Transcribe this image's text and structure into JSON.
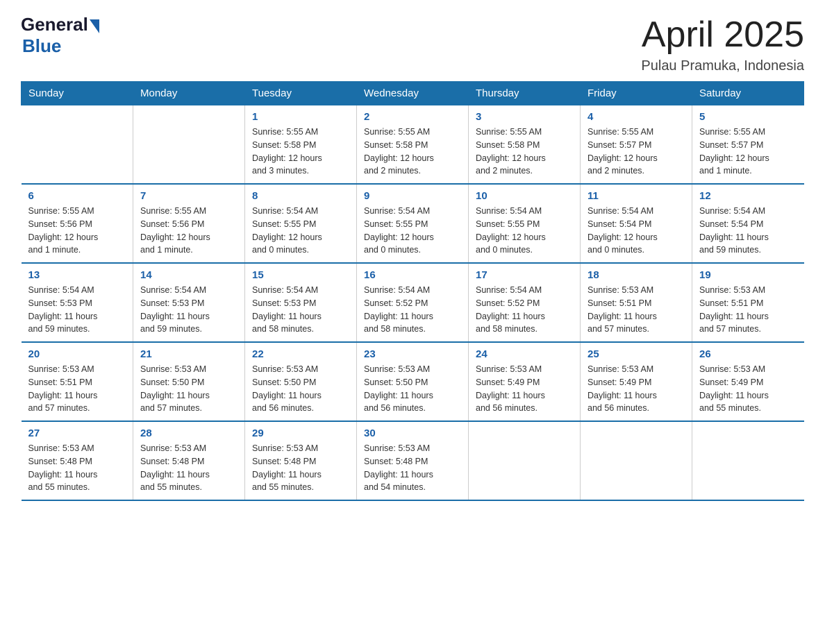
{
  "logo": {
    "general": "General",
    "blue": "Blue"
  },
  "title": "April 2025",
  "location": "Pulau Pramuka, Indonesia",
  "weekdays": [
    "Sunday",
    "Monday",
    "Tuesday",
    "Wednesday",
    "Thursday",
    "Friday",
    "Saturday"
  ],
  "weeks": [
    [
      {
        "day": "",
        "info": ""
      },
      {
        "day": "",
        "info": ""
      },
      {
        "day": "1",
        "info": "Sunrise: 5:55 AM\nSunset: 5:58 PM\nDaylight: 12 hours\nand 3 minutes."
      },
      {
        "day": "2",
        "info": "Sunrise: 5:55 AM\nSunset: 5:58 PM\nDaylight: 12 hours\nand 2 minutes."
      },
      {
        "day": "3",
        "info": "Sunrise: 5:55 AM\nSunset: 5:58 PM\nDaylight: 12 hours\nand 2 minutes."
      },
      {
        "day": "4",
        "info": "Sunrise: 5:55 AM\nSunset: 5:57 PM\nDaylight: 12 hours\nand 2 minutes."
      },
      {
        "day": "5",
        "info": "Sunrise: 5:55 AM\nSunset: 5:57 PM\nDaylight: 12 hours\nand 1 minute."
      }
    ],
    [
      {
        "day": "6",
        "info": "Sunrise: 5:55 AM\nSunset: 5:56 PM\nDaylight: 12 hours\nand 1 minute."
      },
      {
        "day": "7",
        "info": "Sunrise: 5:55 AM\nSunset: 5:56 PM\nDaylight: 12 hours\nand 1 minute."
      },
      {
        "day": "8",
        "info": "Sunrise: 5:54 AM\nSunset: 5:55 PM\nDaylight: 12 hours\nand 0 minutes."
      },
      {
        "day": "9",
        "info": "Sunrise: 5:54 AM\nSunset: 5:55 PM\nDaylight: 12 hours\nand 0 minutes."
      },
      {
        "day": "10",
        "info": "Sunrise: 5:54 AM\nSunset: 5:55 PM\nDaylight: 12 hours\nand 0 minutes."
      },
      {
        "day": "11",
        "info": "Sunrise: 5:54 AM\nSunset: 5:54 PM\nDaylight: 12 hours\nand 0 minutes."
      },
      {
        "day": "12",
        "info": "Sunrise: 5:54 AM\nSunset: 5:54 PM\nDaylight: 11 hours\nand 59 minutes."
      }
    ],
    [
      {
        "day": "13",
        "info": "Sunrise: 5:54 AM\nSunset: 5:53 PM\nDaylight: 11 hours\nand 59 minutes."
      },
      {
        "day": "14",
        "info": "Sunrise: 5:54 AM\nSunset: 5:53 PM\nDaylight: 11 hours\nand 59 minutes."
      },
      {
        "day": "15",
        "info": "Sunrise: 5:54 AM\nSunset: 5:53 PM\nDaylight: 11 hours\nand 58 minutes."
      },
      {
        "day": "16",
        "info": "Sunrise: 5:54 AM\nSunset: 5:52 PM\nDaylight: 11 hours\nand 58 minutes."
      },
      {
        "day": "17",
        "info": "Sunrise: 5:54 AM\nSunset: 5:52 PM\nDaylight: 11 hours\nand 58 minutes."
      },
      {
        "day": "18",
        "info": "Sunrise: 5:53 AM\nSunset: 5:51 PM\nDaylight: 11 hours\nand 57 minutes."
      },
      {
        "day": "19",
        "info": "Sunrise: 5:53 AM\nSunset: 5:51 PM\nDaylight: 11 hours\nand 57 minutes."
      }
    ],
    [
      {
        "day": "20",
        "info": "Sunrise: 5:53 AM\nSunset: 5:51 PM\nDaylight: 11 hours\nand 57 minutes."
      },
      {
        "day": "21",
        "info": "Sunrise: 5:53 AM\nSunset: 5:50 PM\nDaylight: 11 hours\nand 57 minutes."
      },
      {
        "day": "22",
        "info": "Sunrise: 5:53 AM\nSunset: 5:50 PM\nDaylight: 11 hours\nand 56 minutes."
      },
      {
        "day": "23",
        "info": "Sunrise: 5:53 AM\nSunset: 5:50 PM\nDaylight: 11 hours\nand 56 minutes."
      },
      {
        "day": "24",
        "info": "Sunrise: 5:53 AM\nSunset: 5:49 PM\nDaylight: 11 hours\nand 56 minutes."
      },
      {
        "day": "25",
        "info": "Sunrise: 5:53 AM\nSunset: 5:49 PM\nDaylight: 11 hours\nand 56 minutes."
      },
      {
        "day": "26",
        "info": "Sunrise: 5:53 AM\nSunset: 5:49 PM\nDaylight: 11 hours\nand 55 minutes."
      }
    ],
    [
      {
        "day": "27",
        "info": "Sunrise: 5:53 AM\nSunset: 5:48 PM\nDaylight: 11 hours\nand 55 minutes."
      },
      {
        "day": "28",
        "info": "Sunrise: 5:53 AM\nSunset: 5:48 PM\nDaylight: 11 hours\nand 55 minutes."
      },
      {
        "day": "29",
        "info": "Sunrise: 5:53 AM\nSunset: 5:48 PM\nDaylight: 11 hours\nand 55 minutes."
      },
      {
        "day": "30",
        "info": "Sunrise: 5:53 AM\nSunset: 5:48 PM\nDaylight: 11 hours\nand 54 minutes."
      },
      {
        "day": "",
        "info": ""
      },
      {
        "day": "",
        "info": ""
      },
      {
        "day": "",
        "info": ""
      }
    ]
  ]
}
